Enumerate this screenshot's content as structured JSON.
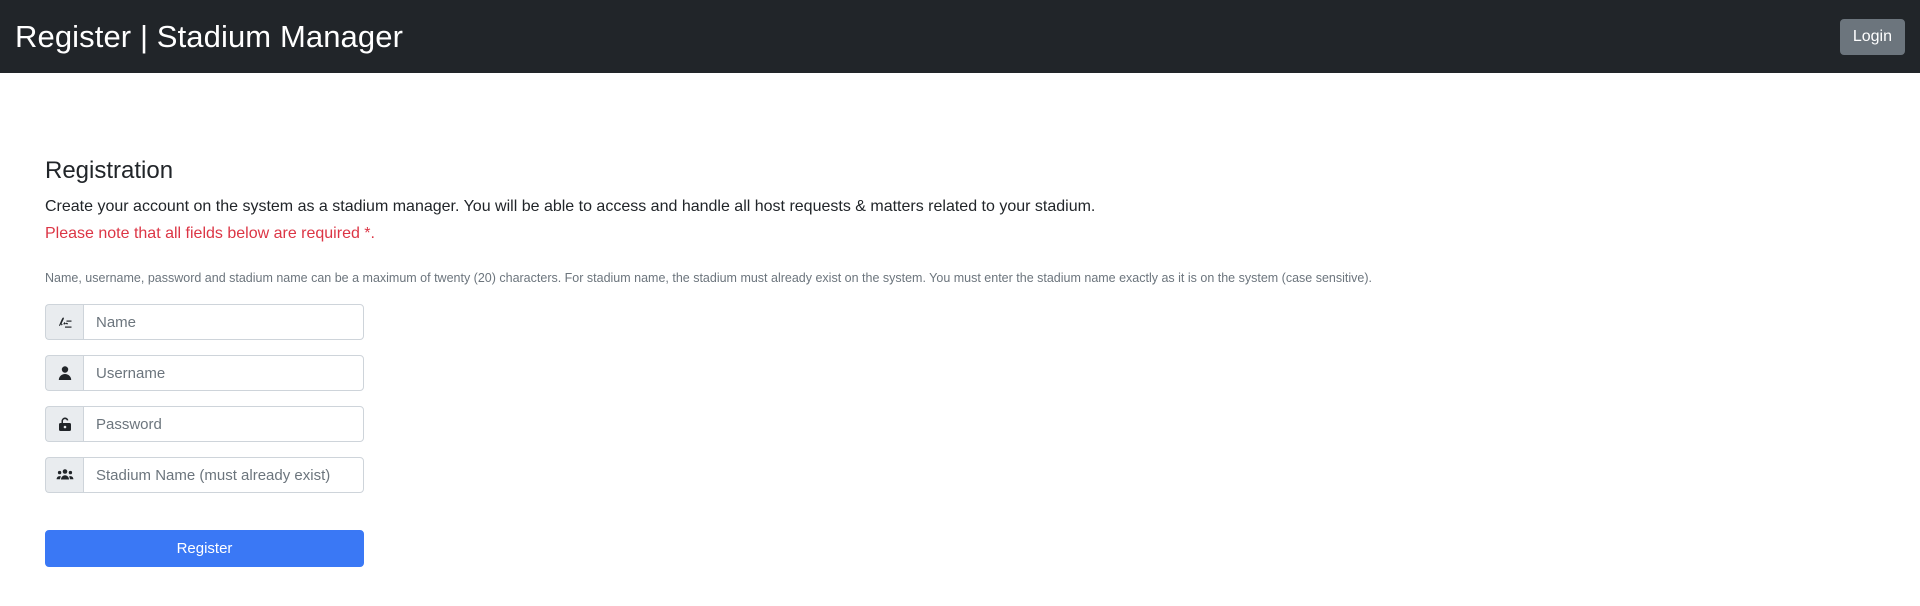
{
  "navbar": {
    "brand": "Register | Stadium Manager",
    "login_label": "Login"
  },
  "registration": {
    "title": "Registration",
    "intro": "Create your account on the system as a stadium manager. You will be able to access and handle all host requests & matters related to your stadium.",
    "required_note": "Please note that all fields below are required *.",
    "hint": "Name, username, password and stadium name can be a maximum of twenty (20) characters. For stadium name, the stadium must already exist on the system. You must enter the stadium name exactly as it is on the system (case sensitive).",
    "fields": [
      {
        "icon": "signature-icon",
        "value": "",
        "placeholder": "Name"
      },
      {
        "icon": "user-icon",
        "value": "",
        "placeholder": "Username"
      },
      {
        "icon": "unlock-icon",
        "value": "",
        "placeholder": "Password"
      },
      {
        "icon": "people-group-icon",
        "value": "",
        "placeholder": "Stadium Name (must already exist)"
      }
    ],
    "register_label": "Register"
  },
  "colors": {
    "navbar_bg": "#212529",
    "login_button": "#6c757d",
    "register_button": "#3a78f5",
    "required_note": "#dc3545"
  }
}
